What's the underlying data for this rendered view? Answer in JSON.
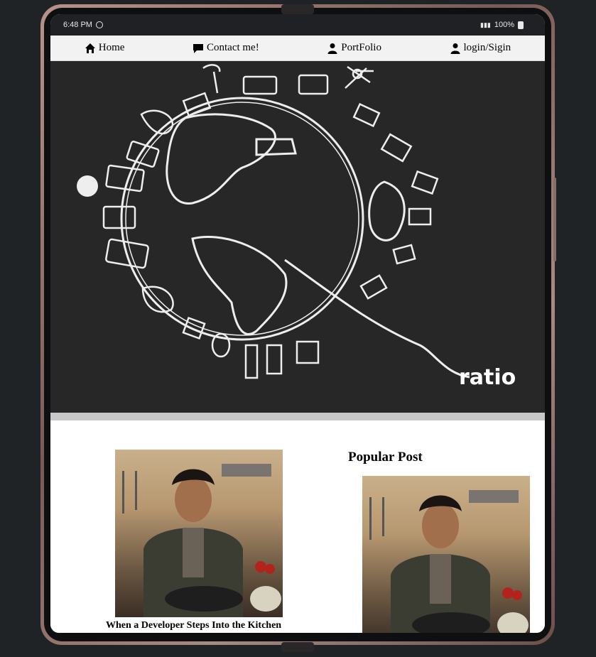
{
  "status_bar": {
    "time": "6:48 PM",
    "signal": "▐",
    "battery": "100%"
  },
  "nav": {
    "home": "Home",
    "contact": "Contact me!",
    "portfolio": "PortFolio",
    "login": "login/Sigin"
  },
  "hero": {
    "logo_text": "ratio"
  },
  "posts": {
    "main_caption": "When a Developer Steps Into the Kitchen",
    "popular_title": "Popular Post"
  },
  "icons": [
    "home-icon",
    "chat-icon",
    "user-icon",
    "user-icon"
  ],
  "colors": {
    "hero_bg": "#272727",
    "navbar_bg": "#f2f2f2",
    "status_bg": "#202124",
    "page_bg": "#1f2326"
  }
}
